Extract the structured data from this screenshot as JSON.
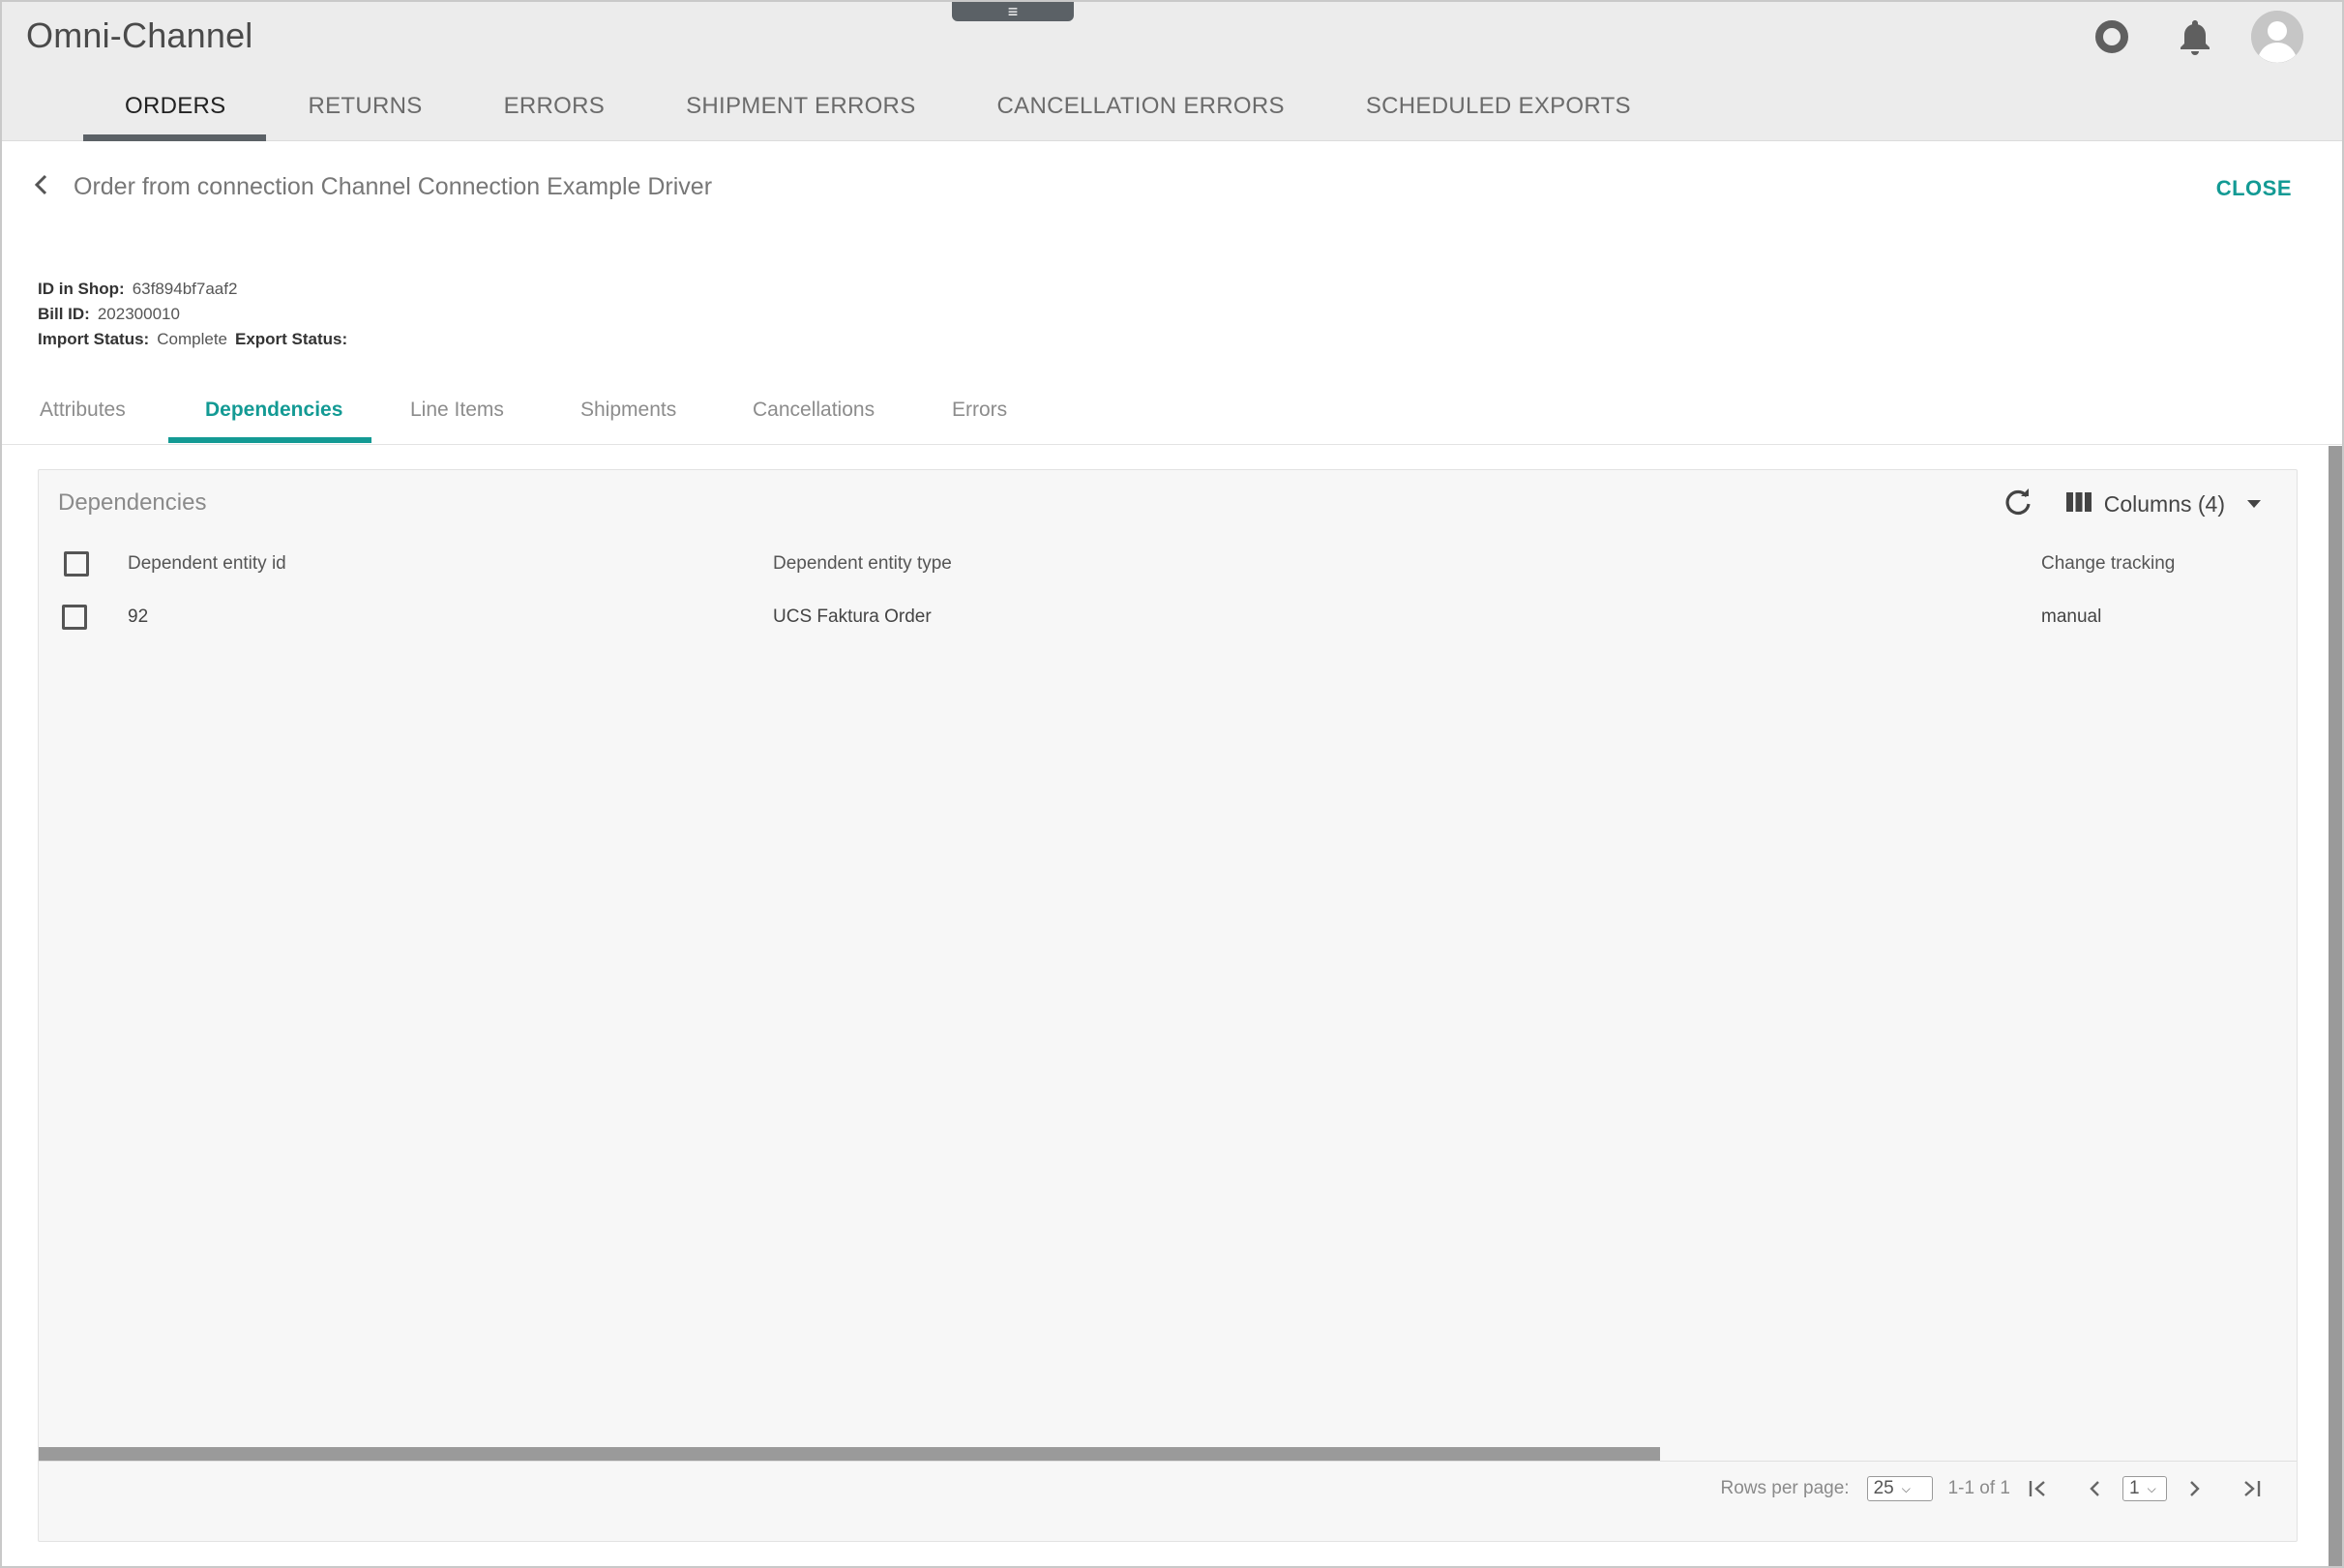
{
  "app": {
    "title": "Omni-Channel",
    "drag_handle": "≡"
  },
  "main_tabs": [
    "ORDERS",
    "RETURNS",
    "ERRORS",
    "SHIPMENT ERRORS",
    "CANCELLATION ERRORS",
    "SCHEDULED EXPORTS"
  ],
  "active_main_tab": "ORDERS",
  "detail": {
    "title": "Order from connection Channel Connection Example Driver",
    "close_label": "CLOSE",
    "id_in_shop_label": "ID in Shop:",
    "id_in_shop": "63f894bf7aaf2",
    "bill_id_label": "Bill ID:",
    "bill_id": "202300010",
    "import_status_label": "Import Status:",
    "import_status": "Complete",
    "export_status_label": "Export Status:",
    "export_status": ""
  },
  "sub_tabs": [
    "Attributes",
    "Dependencies",
    "Line Items",
    "Shipments",
    "Cancellations",
    "Errors"
  ],
  "active_sub_tab": "Dependencies",
  "dependencies": {
    "title": "Dependencies",
    "columns_label": "Columns (4)",
    "headers": [
      "Dependent entity id",
      "Dependent entity type",
      "Change tracking"
    ],
    "rows": [
      {
        "id": "92",
        "type": "UCS Faktura Order",
        "tracking": "manual"
      }
    ],
    "pager": {
      "rows_per_page_label": "Rows per page:",
      "rows_per_page": "25",
      "range": "1-1 of 1",
      "page": "1"
    }
  },
  "colors": {
    "accent": "#139a94",
    "appbar": "#ececec",
    "tab_indicator": "#5b6166"
  },
  "icons": [
    "help-ring-icon",
    "bell-icon",
    "user-avatar-icon",
    "chevron-left-icon",
    "refresh-icon",
    "columns-icon",
    "caret-down-icon",
    "first-page-icon",
    "prev-page-icon",
    "next-page-icon",
    "last-page-icon"
  ]
}
